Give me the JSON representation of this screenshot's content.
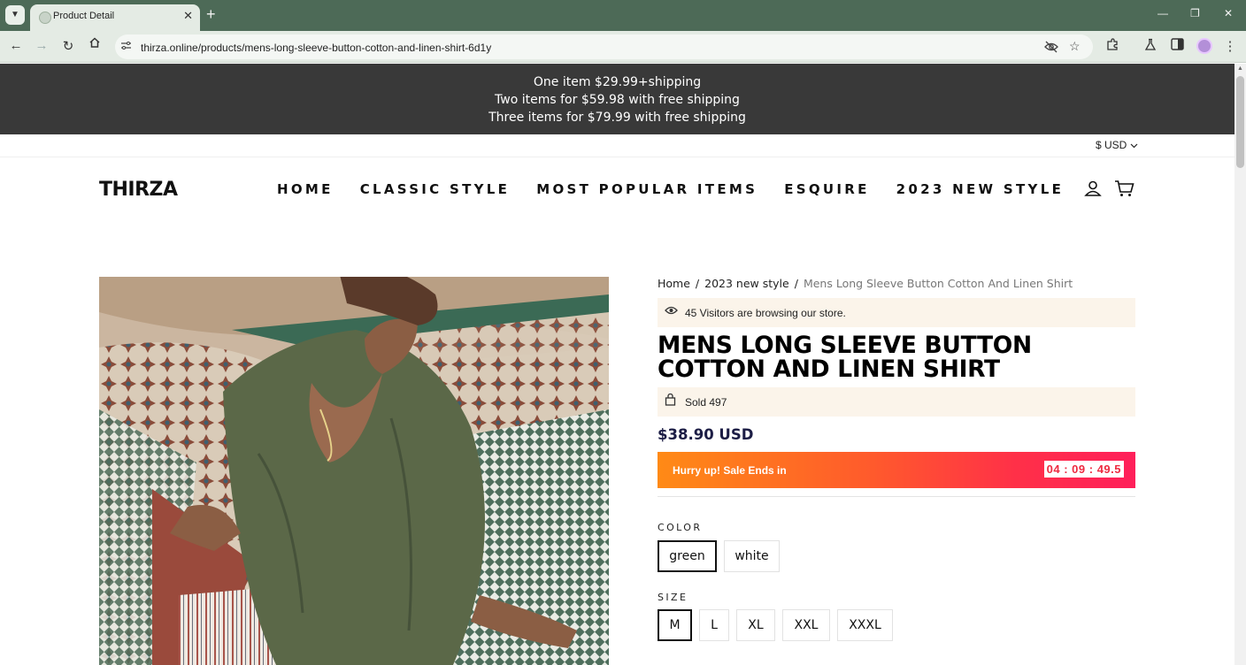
{
  "browser": {
    "tab_title": "Product Detail",
    "url": "thirza.online/products/mens-long-sleeve-button-cotton-and-linen-shirt-6d1y"
  },
  "announcement": {
    "lines": [
      "One item $29.99+shipping",
      "Two items for $59.98 with free shipping",
      "Three items for $79.99 with free shipping"
    ]
  },
  "currency": "$ USD",
  "header": {
    "logo": "THIRZA",
    "nav": [
      "HOME",
      "CLASSIC STYLE",
      "MOST POPULAR ITEMS",
      "ESQUIRE",
      "2023 NEW STYLE"
    ]
  },
  "breadcrumb": {
    "home": "Home",
    "collection": "2023 new style",
    "current": "Mens Long Sleeve Button Cotton And Linen Shirt",
    "separator": "/"
  },
  "product": {
    "visitors_text": "45 Visitors are browsing our store.",
    "title": "MENS LONG SLEEVE BUTTON COTTON AND LINEN SHIRT",
    "sold_text": "Sold 497",
    "price": "$38.90 USD",
    "sale_label": "Hurry up! Sale Ends in",
    "countdown": "04 : 09 : 49.5",
    "color_label": "COLOR",
    "colors": [
      "green",
      "white"
    ],
    "selected_color": "green",
    "size_label": "SIZE",
    "sizes": [
      "M",
      "L",
      "XL",
      "XXL",
      "XXXL"
    ],
    "selected_size": "M"
  },
  "colors": {
    "chrome": "#4d6a57",
    "announcement_bg": "#393939",
    "price": "#1c1d45",
    "notice_bg": "#fbf4ea",
    "sale_gradient_start": "#ff8a16",
    "sale_gradient_end": "#ff1f5a"
  }
}
